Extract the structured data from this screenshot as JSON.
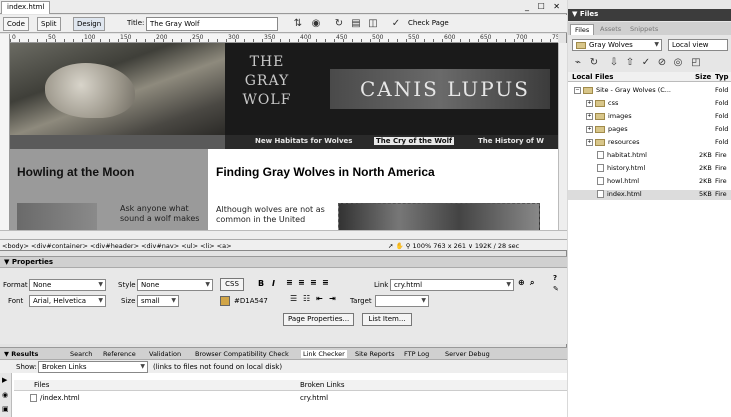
{
  "document": {
    "tab": "index.html",
    "window_controls": "_ ☐ ✕",
    "toolbar": {
      "code": "Code",
      "split": "Split",
      "design": "Design",
      "title_label": "Title:",
      "title_value": "The Gray Wolf",
      "check_page": "Check Page"
    },
    "ruler": [
      "0",
      "50",
      "100",
      "150",
      "200",
      "250",
      "300",
      "350",
      "400",
      "450",
      "500",
      "550",
      "600",
      "650",
      "700",
      "75"
    ]
  },
  "page": {
    "banner_left": "THE\nGRAY\nWOLF",
    "banner_right": "CANIS LUPUS",
    "nav": [
      "New Habitats for Wolves",
      "The Cry of the Wolf",
      "The History of W"
    ],
    "sidebar_heading": "Howling at the Moon",
    "sidebar_text": "Ask anyone what sound a wolf makes",
    "main_heading": "Finding Gray Wolves in North America",
    "main_text": "Although wolves are not as common in the United"
  },
  "status": {
    "tag_selector": "<body> <div#container> <div#header> <div#nav> <ul> <li> <a>",
    "zoom": "100%",
    "size": "763 x 261 ∨ 192K / 28 sec"
  },
  "properties": {
    "title": "▼ Properties",
    "format_label": "Format",
    "format_value": "None",
    "style_label": "Style",
    "style_value": "None",
    "css_button": "CSS",
    "bold": "B",
    "italic": "I",
    "link_label": "Link",
    "link_value": "cry.html",
    "font_label": "Font",
    "font_value": "Arial, Helvetica",
    "size_label": "Size",
    "size_value": "small",
    "color_value": "#D1A547",
    "target_label": "Target",
    "page_properties": "Page Properties...",
    "list_item": "List Item..."
  },
  "results": {
    "title": "▼ Results",
    "tabs": [
      "Search",
      "Reference",
      "Validation",
      "Browser Compatibility Check",
      "Link Checker",
      "Site Reports",
      "FTP Log",
      "Server Debug"
    ],
    "show_label": "Show:",
    "show_value": "Broken Links",
    "show_hint": "(links to files not found on local disk)",
    "col_files": "Files",
    "col_broken": "Broken Links",
    "row_file": "/index.html",
    "row_broken": "cry.html"
  },
  "files_panel": {
    "title": "▼ Files",
    "tabs": [
      "Files",
      "Assets",
      "Snippets"
    ],
    "site": "Gray Wolves",
    "view": "Local view",
    "col_local": "Local Files",
    "col_size": "Size",
    "col_type": "Typ",
    "items": [
      {
        "name": "Site - Gray Wolves (C...",
        "size": "",
        "type": "Fold"
      },
      {
        "name": "css",
        "size": "",
        "type": "Fold"
      },
      {
        "name": "images",
        "size": "",
        "type": "Fold"
      },
      {
        "name": "pages",
        "size": "",
        "type": "Fold"
      },
      {
        "name": "resources",
        "size": "",
        "type": "Fold"
      },
      {
        "name": "habitat.html",
        "size": "2KB",
        "type": "Fire"
      },
      {
        "name": "history.html",
        "size": "2KB",
        "type": "Fire"
      },
      {
        "name": "howl.html",
        "size": "2KB",
        "type": "Fire"
      },
      {
        "name": "index.html",
        "size": "5KB",
        "type": "Fire"
      }
    ]
  }
}
